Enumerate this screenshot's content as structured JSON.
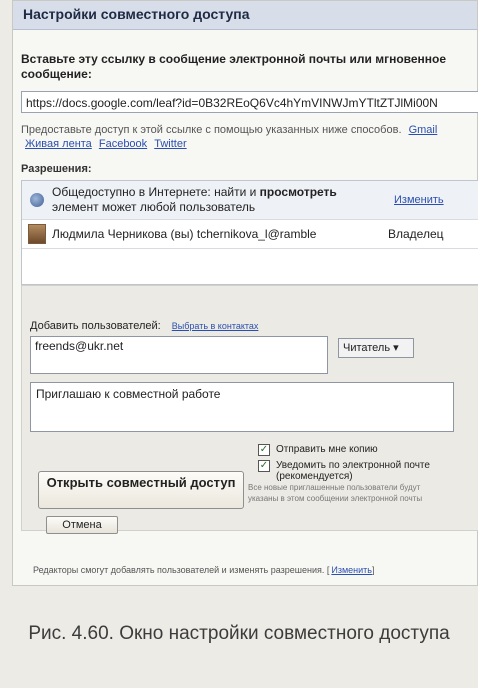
{
  "dialog": {
    "title": "Настройки совместного доступа",
    "instruction": "Вставьте эту ссылку в сообщение электронной почты или мгновенное сообщение:",
    "link_value": "https://docs.google.com/leaf?id=0B32REoQ6Vc4hYmVINWJmYTltZTJlMi00N",
    "share_intro": "Предоставьте доступ к этой ссылке с помощью указанных ниже способов.",
    "share_links": [
      "Gmail",
      "Живая лента",
      "Facebook",
      "Twitter"
    ],
    "permissions_label": "Разрешения:",
    "permissions": [
      {
        "icon": "globe-icon",
        "text_1": "Общедоступно в Интернете: найти и ",
        "text_bold": "просмотреть",
        "text_2": " элемент может любой пользователь",
        "action": "Изменить"
      },
      {
        "icon": "avatar",
        "name": "Людмила Черникова (вы) tchernikova_l@ramble",
        "role": "Владелец"
      }
    ],
    "add_users_label": "Добавить пользователей:",
    "pick_from_contacts": "Выбрать в контактах",
    "email_value": "freends@ukr.net",
    "role_select": "Читатель",
    "message_value": "Приглашаю к совместной  работе",
    "send_copy_label": "Отправить мне копию",
    "notify_label": "Уведомить по электронной почте (рекомендуется)",
    "notify_note": "Все новые приглашенные пользователи будут указаны в этом сообщении электронной почты",
    "share_button": "Открыть совместный доступ",
    "cancel_button": "Отмена",
    "footer_text": "Редакторы смогут добавлять пользователей и изменять разрешения. [",
    "footer_link": "Изменить",
    "footer_end": "]"
  },
  "caption": "Рис. 4.60. Окно настройки совместного доступа"
}
